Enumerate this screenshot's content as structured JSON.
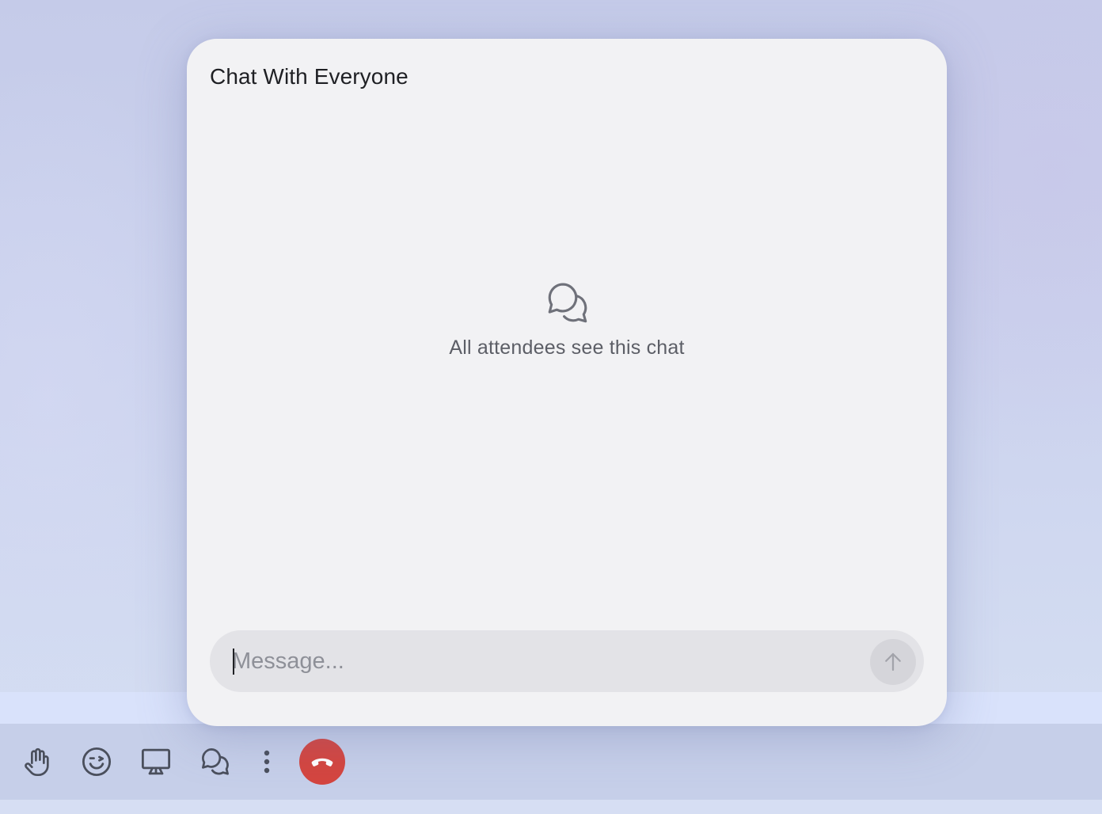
{
  "chat": {
    "title": "Chat With Everyone",
    "empty_state": {
      "icon": "chat-bubbles-icon",
      "text": "All attendees see this chat"
    },
    "composer": {
      "value": "",
      "placeholder": "Message...",
      "send_icon": "arrow-up-icon"
    }
  },
  "toolbar": {
    "buttons": [
      {
        "icon": "raise-hand-icon"
      },
      {
        "icon": "reactions-icon"
      },
      {
        "icon": "share-screen-icon"
      },
      {
        "icon": "chat-icon"
      },
      {
        "icon": "more-icon"
      },
      {
        "icon": "end-call-icon"
      }
    ]
  },
  "colors": {
    "end_call": "#d4453f",
    "panel_bg": "#f2f2f4",
    "composer_bg": "#e3e3e7",
    "toolbar_bg": "#c6cfe9"
  }
}
